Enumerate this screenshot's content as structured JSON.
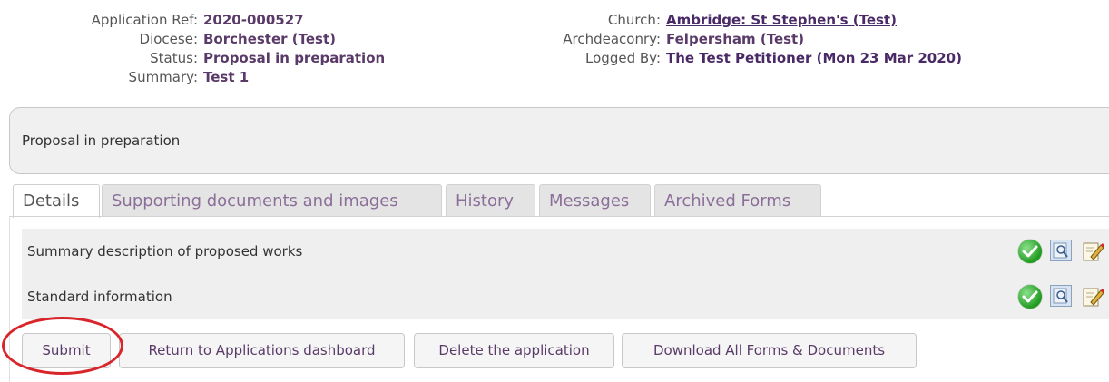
{
  "application": {
    "ref_label": "Application Ref:",
    "ref_value": "2020-000527",
    "diocese_label": "Diocese:",
    "diocese_value": "Borchester (Test)",
    "status_label": "Status:",
    "status_value": "Proposal in preparation",
    "summary_label": "Summary:",
    "summary_value": "Test 1",
    "church_label": "Church:",
    "church_value": "Ambridge: St Stephen's (Test)",
    "archdeaconry_label": "Archdeaconry:",
    "archdeaconry_value": "Felpersham (Test)",
    "logged_by_label": "Logged By:",
    "logged_by_value": "The Test Petitioner (Mon 23 Mar 2020)"
  },
  "status_panel": {
    "text": "Proposal in preparation"
  },
  "tabs": [
    {
      "label": "Details",
      "active": true
    },
    {
      "label": "Supporting documents and images",
      "active": false
    },
    {
      "label": "History",
      "active": false
    },
    {
      "label": "Messages",
      "active": false
    },
    {
      "label": "Archived Forms",
      "active": false
    }
  ],
  "details_items": [
    {
      "label": "Summary description of proposed works",
      "icons": [
        "check-icon",
        "view-icon",
        "edit-icon"
      ]
    },
    {
      "label": "Standard information",
      "icons": [
        "check-icon",
        "view-icon",
        "edit-icon"
      ]
    }
  ],
  "buttons": {
    "submit": "Submit",
    "return_dashboard": "Return to Applications dashboard",
    "delete": "Delete the application",
    "download_all": "Download All Forms & Documents"
  },
  "colors": {
    "accent_text": "#5a3a68",
    "callout": "#d8252b",
    "check_green": "#1f9a1f"
  }
}
